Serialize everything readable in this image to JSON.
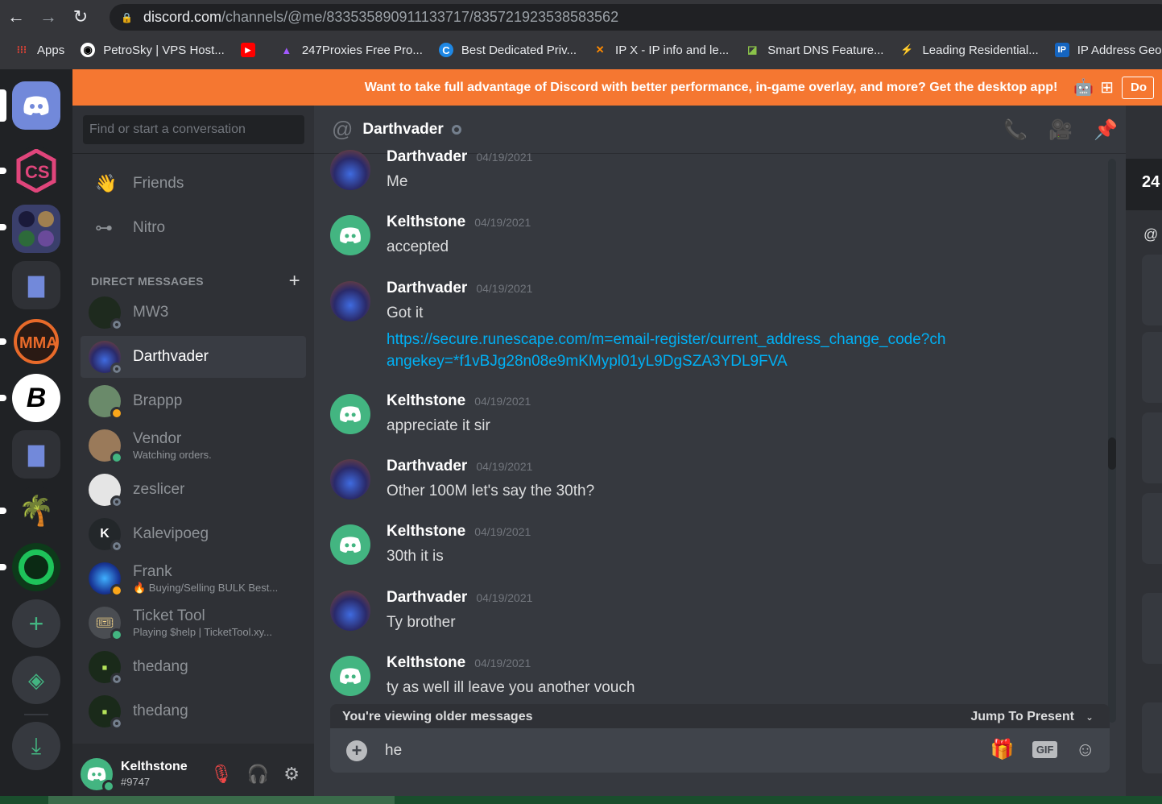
{
  "browser": {
    "url_host": "discord.com",
    "url_path": "/channels/@me/833535890911133717/835721923538583562",
    "bookmarks": [
      {
        "label": "Apps",
        "icon": "apps-grid-icon"
      },
      {
        "label": "PetroSky | VPS Host...",
        "icon": "petrosky-icon"
      },
      {
        "label": "",
        "icon": "youtube-icon"
      },
      {
        "label": "247Proxies Free Pro...",
        "icon": "247proxies-icon"
      },
      {
        "label": "Best Dedicated Priv...",
        "icon": "dedicated-icon"
      },
      {
        "label": "IP X - IP info and le...",
        "icon": "ipx-icon"
      },
      {
        "label": "Smart DNS Feature...",
        "icon": "smartdns-icon"
      },
      {
        "label": "Leading Residential...",
        "icon": "residential-icon"
      },
      {
        "label": "IP Address Geoloca...",
        "icon": "ip-geo-icon"
      }
    ]
  },
  "banner": {
    "text": "Want to take full advantage of Discord with better performance, in-game overlay, and more? Get the desktop app!",
    "button": "Do"
  },
  "sidebar": {
    "search_placeholder": "Find or start a conversation",
    "friends": "Friends",
    "nitro": "Nitro",
    "dm_header": "DIRECT MESSAGES",
    "dms": [
      {
        "name": "MW3",
        "sub": "",
        "status": "offline",
        "color": "#1e2a1e"
      },
      {
        "name": "Darthvader",
        "sub": "",
        "status": "offline",
        "color": "#3b4a8c",
        "active": true
      },
      {
        "name": "Brappp",
        "sub": "",
        "status": "idle",
        "color": "#5a7a5a"
      },
      {
        "name": "Vendor",
        "sub": "Watching orders.",
        "status": "online",
        "color": "#8a6a4a"
      },
      {
        "name": "zeslicer",
        "sub": "",
        "status": "offline",
        "color": "#dddddd"
      },
      {
        "name": "Kalevipoeg",
        "sub": "",
        "status": "offline",
        "color": "#23272a"
      },
      {
        "name": "Frank",
        "sub": "🔥 Buying/Selling BULK Best...",
        "status": "idle",
        "color": "#1a3a9a"
      },
      {
        "name": "Ticket Tool",
        "sub": "Playing $help | TicketTool.xy...",
        "status": "online",
        "color": "#4a4d52"
      },
      {
        "name": "thedang",
        "sub": "",
        "status": "offline",
        "color": "#1a2a1a"
      },
      {
        "name": "thedang",
        "sub": "",
        "status": "offline",
        "color": "#1a2a1a"
      }
    ],
    "user": {
      "name": "Kelthstone",
      "tag": "#9747"
    }
  },
  "chat": {
    "channel": "Darthvader",
    "messages": [
      {
        "author": "Darthvader",
        "time": "04/19/2021",
        "text": "Me",
        "avatar": "darth"
      },
      {
        "author": "Kelthstone",
        "time": "04/19/2021",
        "text": "accepted",
        "avatar": "discord"
      },
      {
        "author": "Darthvader",
        "time": "04/19/2021",
        "text": "Got it",
        "link": "https://secure.runescape.com/m=email-register/current_address_change_code?changekey=*f1vBJg28n08e9mKMypl01yL9DgSZA3YDL9FVA",
        "avatar": "darth"
      },
      {
        "author": "Kelthstone",
        "time": "04/19/2021",
        "text": "appreciate it sir",
        "avatar": "discord"
      },
      {
        "author": "Darthvader",
        "time": "04/19/2021",
        "text": "Other 100M let's say the 30th?",
        "avatar": "darth"
      },
      {
        "author": "Kelthstone",
        "time": "04/19/2021",
        "text": "30th it is",
        "avatar": "discord"
      },
      {
        "author": "Darthvader",
        "time": "04/19/2021",
        "text": "Ty brother",
        "avatar": "darth"
      },
      {
        "author": "Kelthstone",
        "time": "04/19/2021",
        "text": "ty as well ill leave you another vouch",
        "avatar": "discord"
      }
    ],
    "older_notice": "You're viewing older messages",
    "jump_label": "Jump To Present",
    "composer_value": "he",
    "gif_label": "GIF"
  },
  "right_panel": {
    "count": "24"
  },
  "colors": {
    "blurple": "#7289da",
    "green": "#43b581",
    "banner": "#f57731",
    "link": "#00b0f4"
  }
}
